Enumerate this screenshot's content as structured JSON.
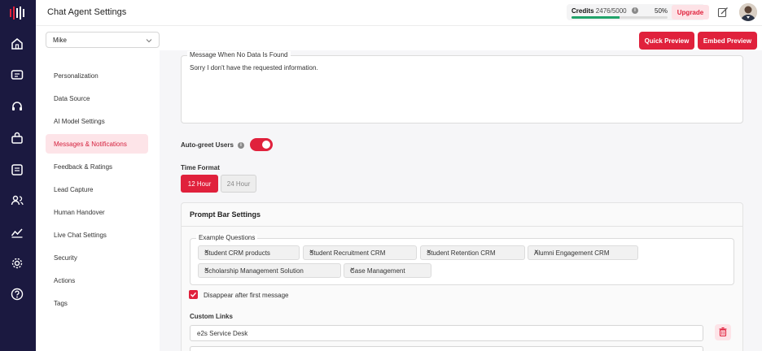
{
  "header": {
    "title": "Chat Agent Settings",
    "credits_label": "Credits",
    "credits_value": "2476/5000",
    "credits_percent": "50%",
    "credits_progress": 0.5,
    "upgrade_label": "Upgrade"
  },
  "agent_select": {
    "value": "Mike"
  },
  "actions": {
    "quick_preview": "Quick Preview",
    "embed_preview": "Embed Preview"
  },
  "rail": {
    "icons": [
      "logo-icon",
      "home-icon",
      "chat-icon",
      "headset-icon",
      "bag-icon",
      "report-icon",
      "users-icon",
      "analytics-icon",
      "gear-icon",
      "help-icon"
    ]
  },
  "sidebar": {
    "items": [
      {
        "label": "Personalization"
      },
      {
        "label": "Data Source"
      },
      {
        "label": "AI Model Settings"
      },
      {
        "label": "Messages & Notifications",
        "active": true
      },
      {
        "label": "Feedback & Ratings"
      },
      {
        "label": "Lead Capture"
      },
      {
        "label": "Human Handover"
      },
      {
        "label": "Live Chat Settings"
      },
      {
        "label": "Security"
      },
      {
        "label": "Actions"
      },
      {
        "label": "Tags"
      }
    ]
  },
  "main": {
    "no_data_label": "Message When No Data Is Found",
    "no_data_value": "Sorry I don't have the requested information.",
    "auto_greet_label": "Auto-greet Users",
    "auto_greet_on": true,
    "time_format_label": "Time Format",
    "time_12": "12 Hour",
    "time_24": "24 Hour",
    "prompt_bar_title": "Prompt Bar Settings",
    "example_questions_label": "Example Questions",
    "example_questions": [
      "Student CRM products",
      "Student Recruitment CRM",
      "Student Retention CRM",
      "Alumni Engagement CRM",
      "Scholarship Management Solution",
      "Case Management"
    ],
    "disappear_label": "Disappear after first message",
    "disappear_checked": true,
    "custom_links_label": "Custom Links",
    "custom_link_1": "e2s Service Desk"
  },
  "colors": {
    "accent": "#e0213c",
    "rail": "#1b1940",
    "success": "#21a36a"
  }
}
